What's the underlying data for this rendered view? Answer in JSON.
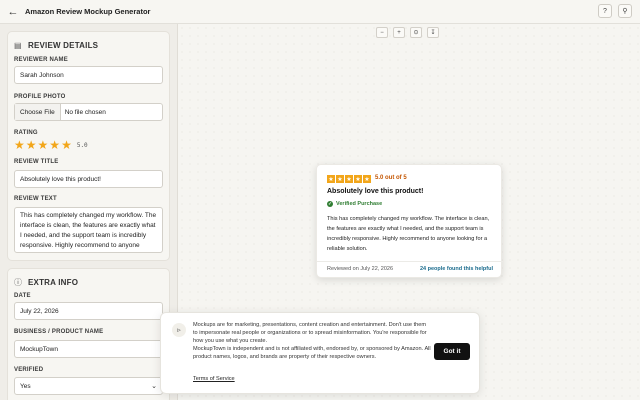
{
  "app": {
    "title": "Amazon Review Mockup Generator"
  },
  "topbar": {
    "help_icon": "help-icon",
    "search_icon": "search-icon"
  },
  "review_details": {
    "heading": "REVIEW DETAILS",
    "reviewer_name_label": "REVIEWER NAME",
    "reviewer_name_value": "Sarah Johnson",
    "profile_photo_label": "PROFILE PHOTO",
    "choose_file_label": "Choose File",
    "file_status": "No file chosen",
    "rating_label": "RATING",
    "rating_value": "5.0",
    "rating_stars": 5,
    "review_title_label": "REVIEW TITLE",
    "review_title_value": "Absolutely love this product!",
    "review_text_label": "REVIEW TEXT",
    "review_text_value": "This has completely changed my workflow. The interface is clean, the features are exactly what I needed, and the support team is incredibly responsive. Highly recommend to anyone looking for a reliable solution."
  },
  "extra_info": {
    "heading": "EXTRA INFO",
    "date_label": "DATE",
    "date_value": "July 22, 2026",
    "business_label": "BUSINESS / PRODUCT NAME",
    "business_value": "MockupTown",
    "verified_label": "VERIFIED",
    "verified_value": "Yes"
  },
  "preview": {
    "score_text": "5.0 out of 5",
    "title": "Absolutely love this product!",
    "verified_text": "Verified Purchase",
    "body": "This has completely changed my workflow. The interface is clean, the features are exactly what I needed, and the support team is incredibly responsive. Highly recommend to anyone looking for a reliable solution.",
    "reviewed_on": "Reviewed on July 22, 2026",
    "helpful": "24 people found this helpful",
    "accent_color": "#f2a61a"
  },
  "notice": {
    "line1": "Mockups are for marketing, presentations, content creation and entertainment. Don't use them to impersonate real people or organizations or to spread misinformation. You're responsible for how you use what you create.",
    "line2": "MockupTown is independent and is not affiliated with, endorsed by, or sponsored by Amazon. All product names, logos, and brands are property of their respective owners.",
    "tos": "Terms of Service",
    "button": "Got it"
  }
}
